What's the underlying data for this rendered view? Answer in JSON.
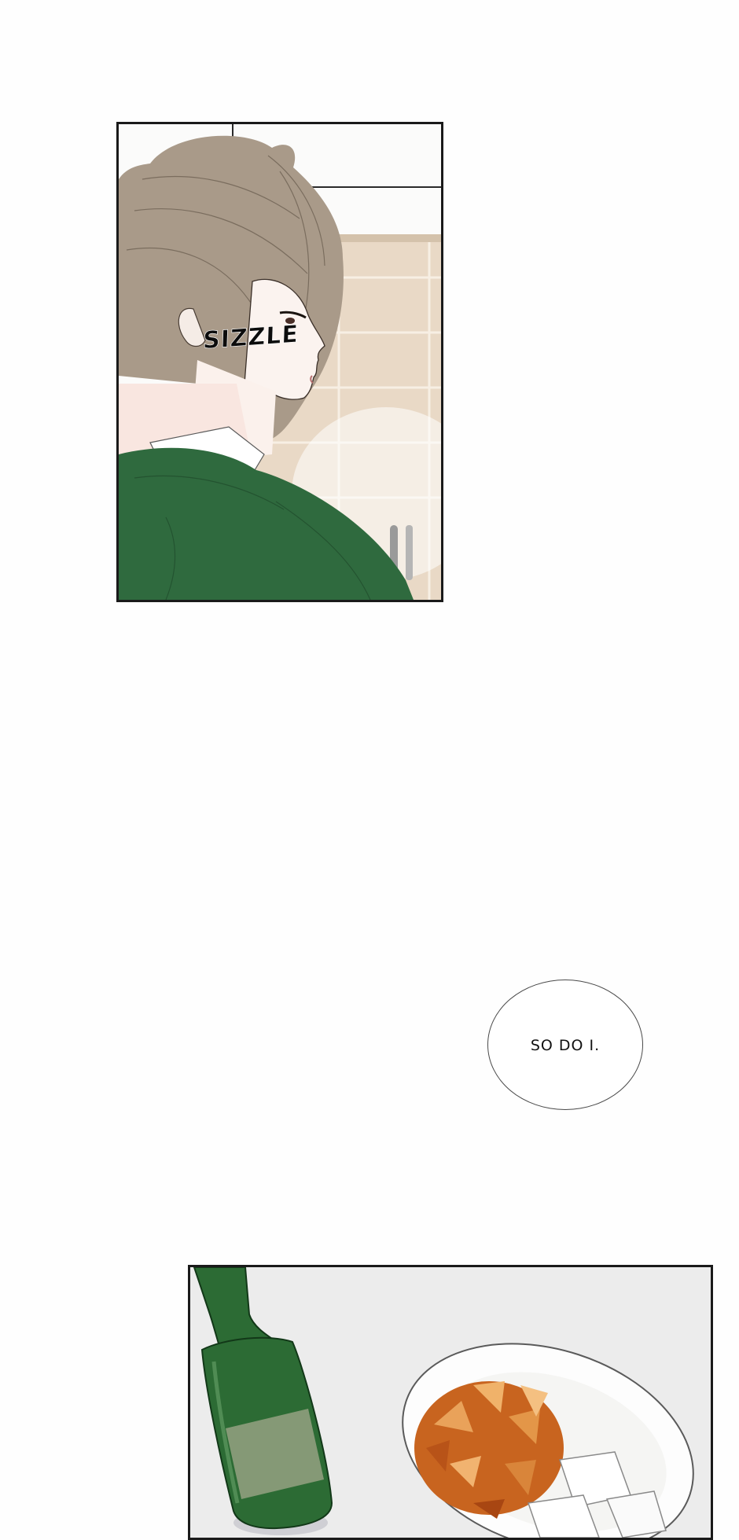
{
  "panels": {
    "first": {
      "sound_effect": "SIZZLE"
    },
    "second": {}
  },
  "speech_bubble": {
    "text": "SO DO I."
  },
  "colors": {
    "sweater_green": "#2f6a3e",
    "hair_brown": "#a99a89",
    "wall_beige": "#e9d9c6",
    "bottle_green": "#2c6b34",
    "food_orange": "#c8641f"
  }
}
